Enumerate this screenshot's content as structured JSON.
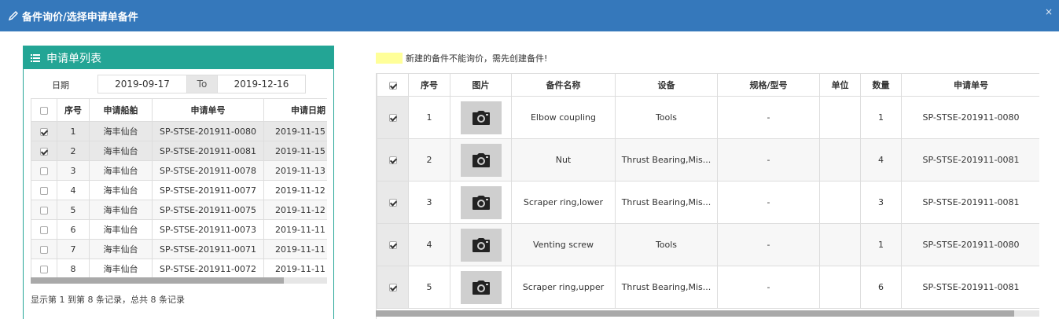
{
  "dialog": {
    "title": "备件询价/选择申请单备件",
    "close_label": "×"
  },
  "left": {
    "title": "申请单列表",
    "date_label": "日期",
    "date_from": "2019-09-17",
    "to_label": "To",
    "date_to": "2019-12-16",
    "columns": [
      "序号",
      "申请船舶",
      "申请单号",
      "申请日期"
    ],
    "rows": [
      {
        "checked": true,
        "no": "1",
        "ship": "海丰仙台",
        "req": "SP-STSE-201911-0080",
        "date": "2019-11-15"
      },
      {
        "checked": true,
        "no": "2",
        "ship": "海丰仙台",
        "req": "SP-STSE-201911-0081",
        "date": "2019-11-15"
      },
      {
        "checked": false,
        "no": "3",
        "ship": "海丰仙台",
        "req": "SP-STSE-201911-0078",
        "date": "2019-11-13"
      },
      {
        "checked": false,
        "no": "4",
        "ship": "海丰仙台",
        "req": "SP-STSE-201911-0077",
        "date": "2019-11-12"
      },
      {
        "checked": false,
        "no": "5",
        "ship": "海丰仙台",
        "req": "SP-STSE-201911-0075",
        "date": "2019-11-12"
      },
      {
        "checked": false,
        "no": "6",
        "ship": "海丰仙台",
        "req": "SP-STSE-201911-0073",
        "date": "2019-11-11"
      },
      {
        "checked": false,
        "no": "7",
        "ship": "海丰仙台",
        "req": "SP-STSE-201911-0071",
        "date": "2019-11-11"
      },
      {
        "checked": false,
        "no": "8",
        "ship": "海丰仙台",
        "req": "SP-STSE-201911-0072",
        "date": "2019-11-11"
      }
    ],
    "footer": "显示第 1 到第 8 条记录，总共 8 条记录"
  },
  "right": {
    "legend_text": "新建的备件不能询价，需先创建备件!",
    "legend_color": "#ffff99",
    "columns": [
      "序号",
      "图片",
      "备件名称",
      "设备",
      "规格/型号",
      "单位",
      "数量",
      "申请单号"
    ],
    "rows": [
      {
        "checked": true,
        "no": "1",
        "name": "Elbow coupling",
        "equip": "Tools",
        "spec": "-",
        "unit": "",
        "qty": "1",
        "req": "SP-STSE-201911-0080"
      },
      {
        "checked": true,
        "no": "2",
        "name": "Nut",
        "equip": "Thrust Bearing,Mis...",
        "spec": "-",
        "unit": "",
        "qty": "4",
        "req": "SP-STSE-201911-0081"
      },
      {
        "checked": true,
        "no": "3",
        "name": "Scraper ring,lower",
        "equip": "Thrust Bearing,Mis...",
        "spec": "-",
        "unit": "",
        "qty": "3",
        "req": "SP-STSE-201911-0081"
      },
      {
        "checked": true,
        "no": "4",
        "name": "Venting screw",
        "equip": "Tools",
        "spec": "-",
        "unit": "",
        "qty": "1",
        "req": "SP-STSE-201911-0080"
      },
      {
        "checked": true,
        "no": "5",
        "name": "Scraper ring,upper",
        "equip": "Thrust Bearing,Mis...",
        "spec": "-",
        "unit": "",
        "qty": "6",
        "req": "SP-STSE-201911-0081"
      }
    ]
  }
}
